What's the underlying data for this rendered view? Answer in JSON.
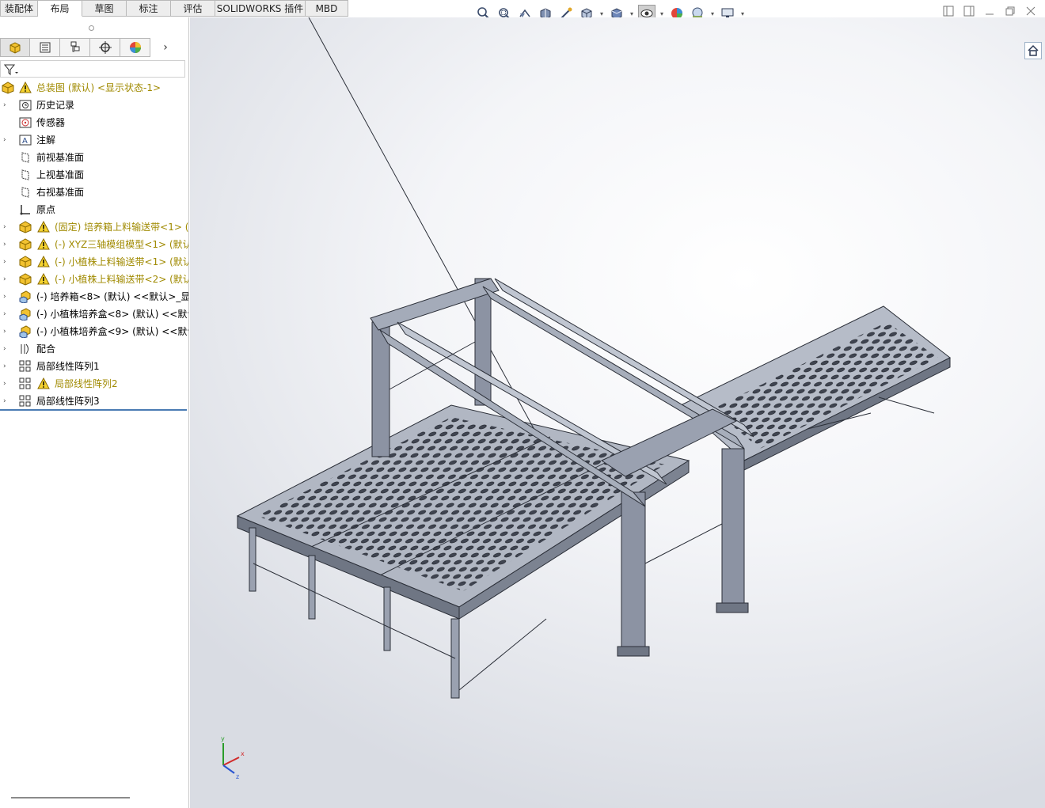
{
  "tabs": [
    {
      "label": "装配体",
      "active": false
    },
    {
      "label": "布局",
      "active": true
    },
    {
      "label": "草图",
      "active": false
    },
    {
      "label": "标注",
      "active": false
    },
    {
      "label": "评估",
      "active": false
    },
    {
      "label": "SOLIDWORKS 插件",
      "active": false
    },
    {
      "label": "MBD",
      "active": false
    }
  ],
  "view_toolbar": {
    "icons": [
      "zoom-to-fit-icon",
      "zoom-to-area-icon",
      "previous-view-icon",
      "section-view-icon",
      "dynamic-annotation-icon",
      "view-orientation-icon",
      "display-style-icon",
      "hide-show-items-icon",
      "edit-appearance-icon",
      "apply-scene-icon",
      "view-settings-icon"
    ]
  },
  "panel_tabs": [
    "feature-manager-icon",
    "property-manager-icon",
    "configuration-manager-icon",
    "dimxpert-manager-icon",
    "display-manager-icon"
  ],
  "tree": {
    "root": {
      "label": "总装图 (默认) <显示状态-1>",
      "warning": true
    },
    "items": [
      {
        "label": "历史记录",
        "expandable": true,
        "icon": "history-icon",
        "warning": false
      },
      {
        "label": "传感器",
        "expandable": false,
        "icon": "sensor-icon",
        "warning": false
      },
      {
        "label": "注解",
        "expandable": true,
        "icon": "annotations-icon",
        "warning": false
      },
      {
        "label": "前视基准面",
        "expandable": false,
        "icon": "plane-icon",
        "warning": false
      },
      {
        "label": "上视基准面",
        "expandable": false,
        "icon": "plane-icon",
        "warning": false
      },
      {
        "label": "右视基准面",
        "expandable": false,
        "icon": "plane-icon",
        "warning": false
      },
      {
        "label": "原点",
        "expandable": false,
        "icon": "origin-icon",
        "warning": false
      },
      {
        "label": "(固定) 培养箱上料输送带<1> (",
        "expandable": true,
        "icon": "subassembly-icon",
        "warning": true
      },
      {
        "label": "(-) XYZ三轴模组模型<1> (默认",
        "expandable": true,
        "icon": "subassembly-icon",
        "warning": true
      },
      {
        "label": "(-) 小植株上料输送带<1> (默认",
        "expandable": true,
        "icon": "subassembly-icon",
        "warning": true
      },
      {
        "label": "(-) 小植株上料输送带<2> (默认",
        "expandable": true,
        "icon": "subassembly-icon",
        "warning": true
      },
      {
        "label": "(-) 培养箱<8> (默认) <<默认>_显",
        "expandable": true,
        "icon": "part-icon",
        "warning": false
      },
      {
        "label": "(-) 小植株培养盒<8> (默认) <<默认",
        "expandable": true,
        "icon": "part-icon",
        "warning": false
      },
      {
        "label": "(-) 小植株培养盒<9> (默认) <<默认",
        "expandable": true,
        "icon": "part-icon",
        "warning": false
      },
      {
        "label": "配合",
        "expandable": true,
        "icon": "mates-icon",
        "warning": false
      },
      {
        "label": "局部线性阵列1",
        "expandable": true,
        "icon": "linear-pattern-icon",
        "warning": false
      },
      {
        "label": "局部线性阵列2",
        "expandable": true,
        "icon": "linear-pattern-icon",
        "warning": true
      },
      {
        "label": "局部线性阵列3",
        "expandable": true,
        "icon": "linear-pattern-icon",
        "warning": false
      }
    ]
  },
  "triad": {
    "x": "x",
    "y": "y",
    "z": "z"
  },
  "colors": {
    "warning_text": "#a08a00",
    "accent": "#4a7bb3",
    "model_steel": "#8c93a3"
  }
}
